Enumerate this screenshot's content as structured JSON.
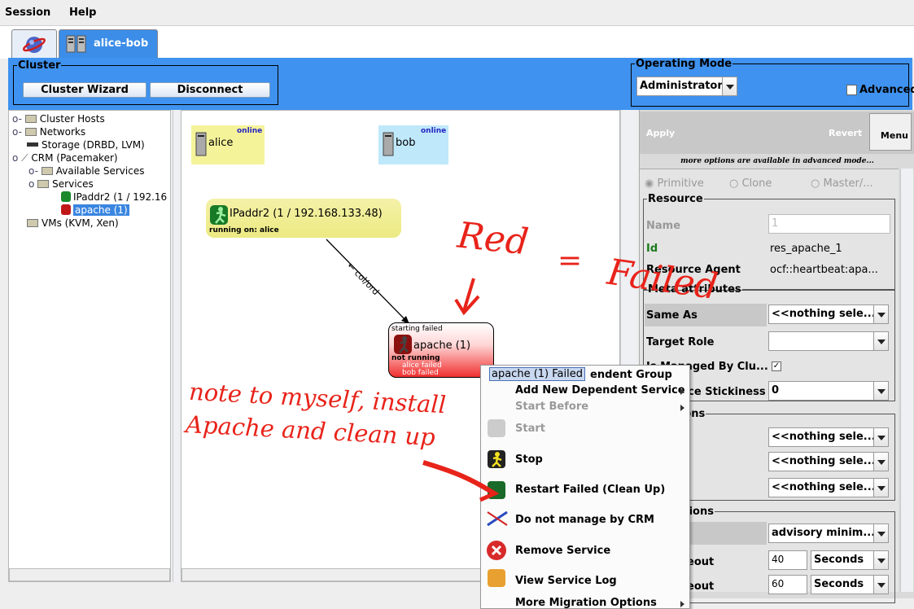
{
  "menubar": {
    "session": "Session",
    "help": "Help"
  },
  "tabs": {
    "cluster_name": "alice-bob"
  },
  "cluster_box": {
    "legend": "Cluster",
    "wizard": "Cluster Wizard",
    "disconnect": "Disconnect"
  },
  "operating_mode": {
    "legend": "Operating Mode",
    "value": "Administrator",
    "advanced": "Advanced"
  },
  "tree": {
    "hosts": "Cluster Hosts",
    "networks": "Networks",
    "storage": "Storage (DRBD, LVM)",
    "crm": "CRM (Pacemaker)",
    "available": "Available Services",
    "services": "Services",
    "ipaddr": "IPaddr2 (1 / 192.16",
    "apache": "apache (1)",
    "vms": "VMs (KVM, Xen)"
  },
  "graph": {
    "alice": {
      "name": "alice",
      "status": "online"
    },
    "bob": {
      "name": "bob",
      "status": "online"
    },
    "ipaddr": {
      "name": "IPaddr2 (1 / 192.168.133.48)",
      "sub": "running on: alice"
    },
    "edge_label": "← col/ord",
    "apache": {
      "name": "apache (1)",
      "top": "starting failed",
      "state": "not running",
      "f1": "alice failed",
      "f2": "bob failed"
    }
  },
  "right": {
    "apply": "Apply",
    "revert": "Revert",
    "menu": "Menu",
    "hint": "more options are available in advanced mode...",
    "radios": [
      "Primitive",
      "Clone",
      "Master/..."
    ],
    "resource_legend": "Resource",
    "name_label": "Name",
    "name_placeholder": "1",
    "id_label": "Id",
    "id_value": "res_apache_1",
    "agent_label": "Resource Agent",
    "agent_value": "ocf::heartbeat:apa...",
    "meta_legend": "Meta attributes",
    "same_as": "Same As",
    "same_as_value": "<<nothing sele...",
    "target_role": "Target Role",
    "managed": "Is Managed By Clu...",
    "stickiness": "Resource Stickiness",
    "stickiness_value": "0",
    "locations_legend": "Locations",
    "loc_values": [
      "<<nothing sele...",
      "<<nothing sele...",
      "<<nothing sele..."
    ],
    "operations_legend": "Operations",
    "advisory": "advisory minim...",
    "timeout1": "40",
    "timeout2": "60",
    "unit1": "Seconds",
    "unit2": "Seconds",
    "timeout_label": "imeout"
  },
  "context_menu": {
    "title": "apache (1) Failed",
    "group_suffix": "endent Group",
    "add_dep": "Add New Dependent Service",
    "start_before": "Start Before",
    "start": "Start",
    "stop": "Stop",
    "restart": "Restart Failed (Clean Up)",
    "unmanage": "Do not manage by CRM",
    "remove": "Remove Service",
    "log": "View Service Log",
    "migration": "More Migration Options"
  },
  "annotations": {
    "red": "Red",
    "equals": "=",
    "failed": "Failed",
    "note1": "note to myself, install",
    "note2": "Apache and clean up"
  }
}
